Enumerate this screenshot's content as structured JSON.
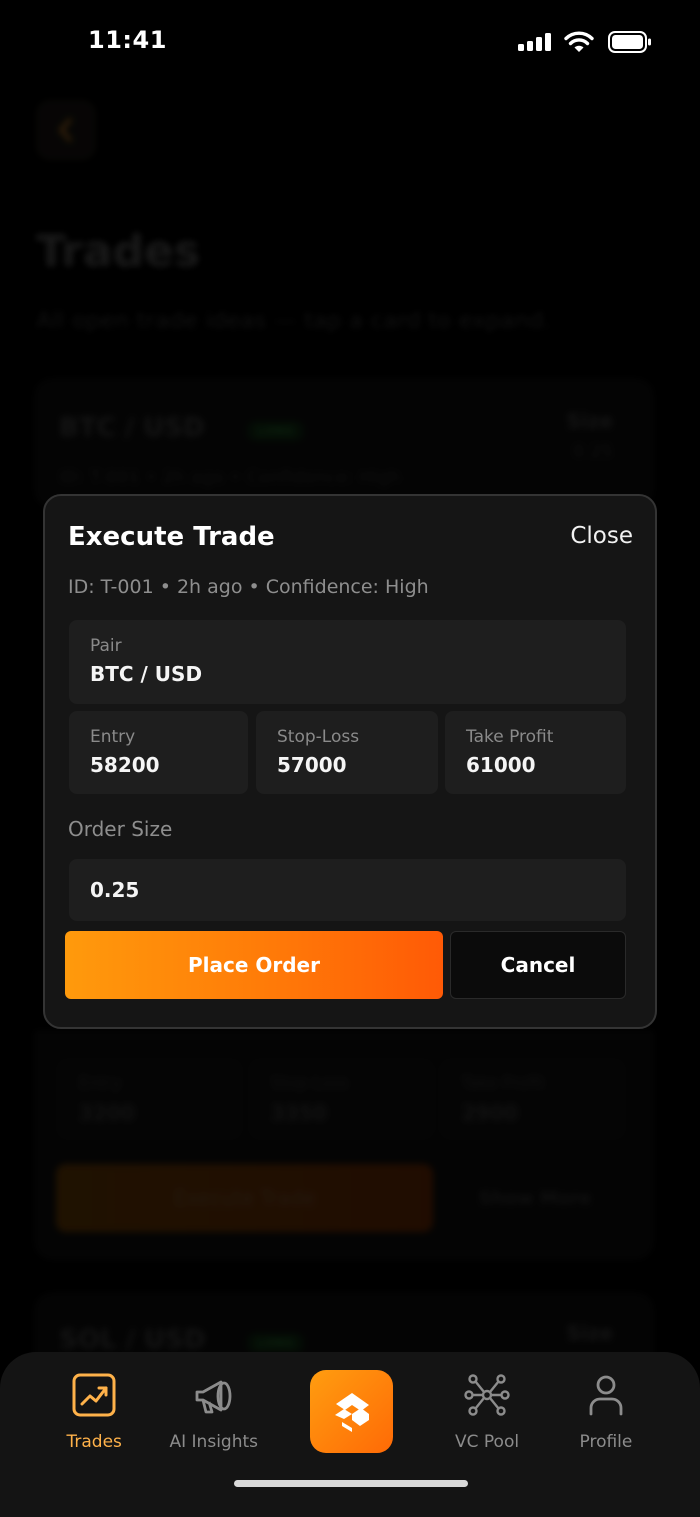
{
  "status_bar": {
    "time": "11:41"
  },
  "background": {
    "title": "Trades",
    "subtitle": "All open trade ideas — tap a card to expand.",
    "cards": [
      {
        "pair": "BTC / USD",
        "tag": "LONG",
        "size_label": "Size",
        "size_value": "0.25",
        "meta": "ID: T-001 • 2h ago • Confidence: High"
      },
      {
        "entry_label": "Entry",
        "entry_value": "3200",
        "sl_label": "Stop-Loss",
        "sl_value": "3350",
        "tp_label": "Take Profit",
        "tp_value": "2900",
        "execute_label": "Execute Trade",
        "more_label": "Show More"
      },
      {
        "pair": "SOL / USD",
        "tag": "LONG",
        "size_label": "Size"
      }
    ]
  },
  "modal": {
    "title": "Execute Trade",
    "close_label": "Close",
    "meta": "ID: T-001 • 2h ago • Confidence: High",
    "pair_label": "Pair",
    "pair_value": "BTC / USD",
    "entry_label": "Entry",
    "entry_value": "58200",
    "stop_loss_label": "Stop-Loss",
    "stop_loss_value": "57000",
    "take_profit_label": "Take Profit",
    "take_profit_value": "61000",
    "order_size_label": "Order Size",
    "order_size_value": "0.25",
    "place_order_label": "Place Order",
    "cancel_label": "Cancel"
  },
  "tab_bar": {
    "items": [
      {
        "label": "Trades",
        "icon": "chart-trend-icon",
        "active": true
      },
      {
        "label": "AI Insights",
        "icon": "megaphone-icon",
        "active": false
      },
      {
        "label": "",
        "icon": "logo-icon",
        "active": false
      },
      {
        "label": "VC Pool",
        "icon": "network-icon",
        "active": false
      },
      {
        "label": "Profile",
        "icon": "user-icon",
        "active": false
      }
    ]
  },
  "colors": {
    "accent": "#ff9a0c",
    "accent_end": "#ff5a06",
    "active_tab": "#ffb24a",
    "modal_bg": "#151515",
    "field_bg": "#1e1e1e"
  }
}
